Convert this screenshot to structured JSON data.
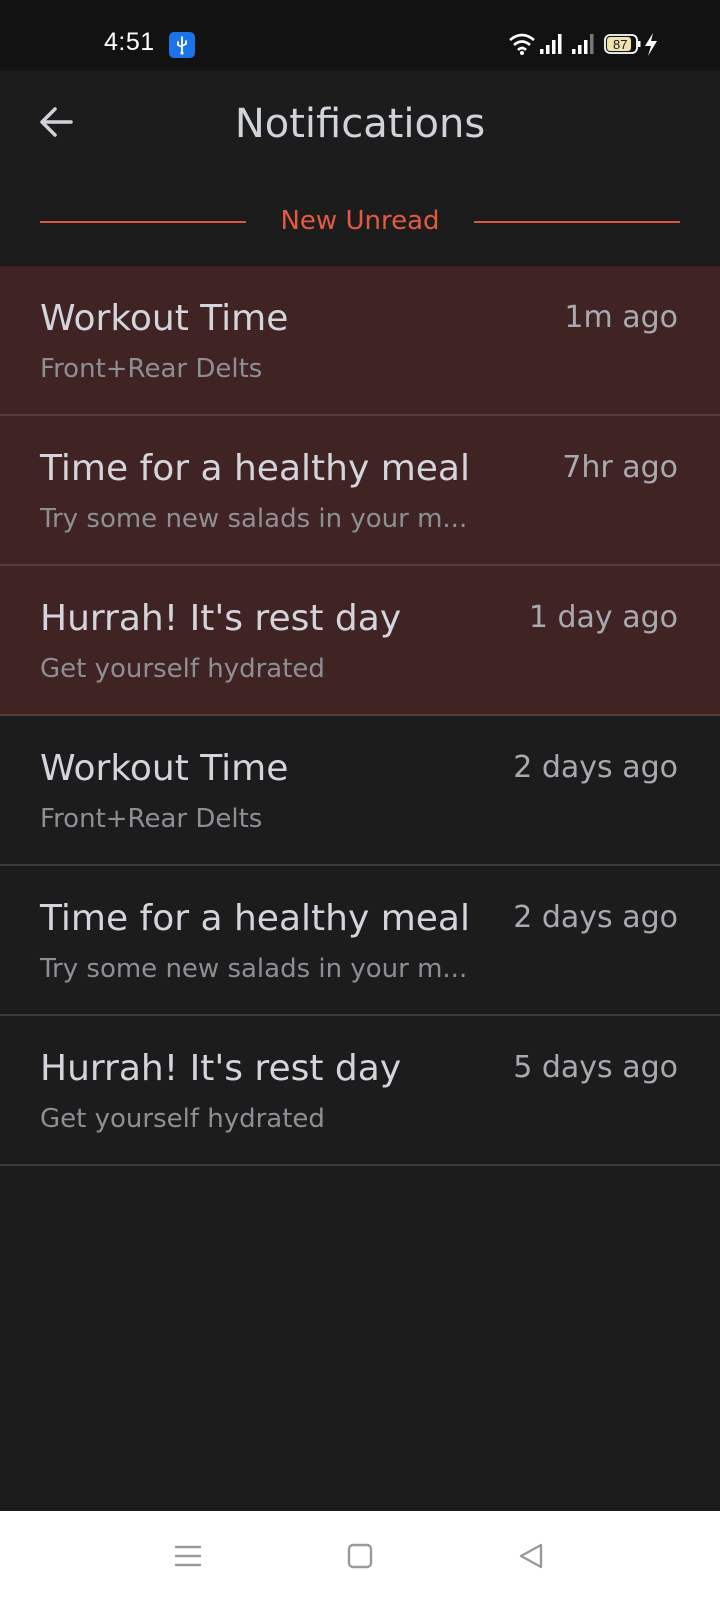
{
  "status_bar": {
    "time": "4:51",
    "battery_level": "87",
    "icons": [
      "usb-icon",
      "wifi-icon",
      "signal-icon",
      "signal-icon",
      "battery-icon",
      "charging-icon"
    ]
  },
  "header": {
    "title": "Notifications",
    "back_icon": "arrow-left-icon"
  },
  "section": {
    "label": "New Unread",
    "accent_color": "#e25a42"
  },
  "notifications": [
    {
      "title": "Workout Time",
      "subtitle": "Front+Rear Delts",
      "time": "1m ago",
      "unread": true
    },
    {
      "title": "Time for a healthy meal",
      "subtitle": "Try some new salads in your m...",
      "time": "7hr ago",
      "unread": true
    },
    {
      "title": "Hurrah! It's rest day",
      "subtitle": "Get yourself hydrated",
      "time": "1 day ago",
      "unread": true
    },
    {
      "title": "Workout Time",
      "subtitle": "Front+Rear Delts",
      "time": "2 days ago",
      "unread": false
    },
    {
      "title": "Time for a healthy meal",
      "subtitle": "Try some new salads in your m...",
      "time": "2 days ago",
      "unread": false
    },
    {
      "title": "Hurrah! It's rest day",
      "subtitle": "Get yourself hydrated",
      "time": "5 days ago",
      "unread": false
    }
  ],
  "colors": {
    "background": "#1c1c1d",
    "unread_background": "#3f2423",
    "title_text": "#d4d5dc",
    "subtitle_text": "#8e8f95"
  },
  "nav_bar": {
    "icons": [
      "menu-icon",
      "home-square-icon",
      "back-triangle-icon"
    ]
  }
}
